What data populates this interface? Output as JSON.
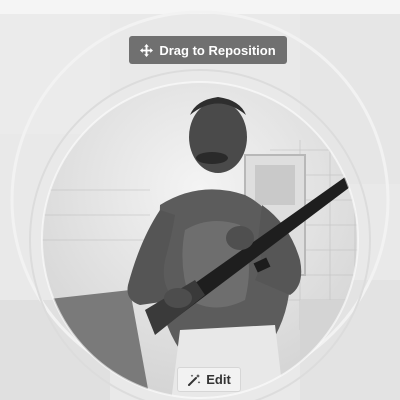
{
  "overlay": {
    "drag_label": "Drag to Reposition",
    "drag_icon": "move-arrows-icon",
    "edit_label": "Edit",
    "edit_icon": "magic-wand-icon"
  },
  "colors": {
    "hint_background": "#4e4e4e",
    "hint_text": "#ffffff",
    "edit_background": "#f2f2f2",
    "edit_text": "#333333"
  }
}
